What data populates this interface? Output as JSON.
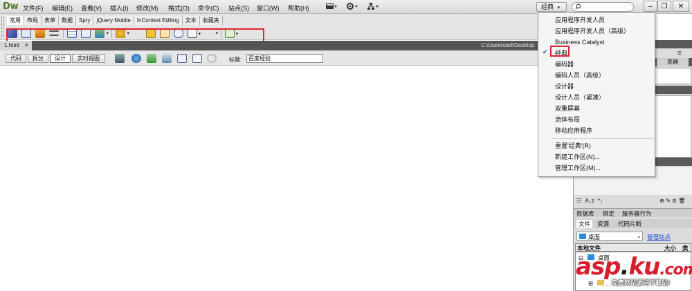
{
  "app": {
    "logo": "Dw"
  },
  "menubar": {
    "items": [
      "文件(F)",
      "编辑(E)",
      "查看(V)",
      "插入(I)",
      "修改(M)",
      "格式(O)",
      "命令(C)",
      "站点(S)",
      "窗口(W)",
      "帮助(H)"
    ],
    "workspace_button": "经典",
    "search_placeholder": ""
  },
  "insert_panel": {
    "tabs": [
      "常用",
      "布局",
      "表单",
      "数据",
      "Spry",
      "jQuery Mobile",
      "InContext Editing",
      "文本",
      "收藏夹"
    ],
    "active_tab": 0
  },
  "document": {
    "tab": "1.html",
    "path": "C:\\Users\\dell\\Desktop"
  },
  "doc_toolbar": {
    "views": [
      "代码",
      "拆分",
      "设计",
      "实时视图"
    ],
    "active_view": 2,
    "title_label": "标题:",
    "title_value": "百度经验"
  },
  "workspace_menu": {
    "items": [
      "应用程序开发人员",
      "应用程序开发人员（高级）",
      "Business Catalyst",
      "经典",
      "编码器",
      "编码人员（高级）",
      "设计器",
      "设计人员（紧凑）",
      "双重屏幕",
      "流体布局",
      "移动应用程序"
    ],
    "checked_item": "经典",
    "actions": [
      "重置'经典'(R)",
      "新建工作区(N)...",
      "管理工作区(M)..."
    ]
  },
  "right_panel": {
    "partial_tab": "查器",
    "db_tabs": [
      "数据库",
      "绑定",
      "服务器行为"
    ],
    "file_tabs": [
      "文件",
      "资源",
      "代码片断"
    ],
    "site_select": "桌面",
    "manage_sites": "管理站点",
    "columns": [
      "本地文件",
      "大小",
      "类"
    ],
    "tree": [
      "桌面",
      "..."
    ]
  },
  "watermark": {
    "brand_left": "asp",
    "brand_dot": ".",
    "brand_right": "ku",
    "brand_com": ".com",
    "subtitle": "免费网站源码下载站!"
  },
  "colors": {
    "highlight_box": "#e0232d",
    "check": "#1a4fa0",
    "watermark": "#d81e2e"
  }
}
